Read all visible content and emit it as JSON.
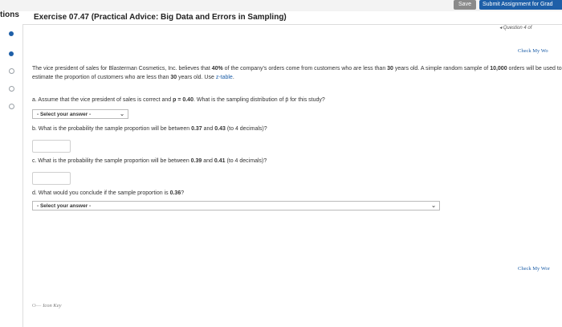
{
  "topbar": {
    "save_label": "Save",
    "submit_label": "Submit Assignment for Grad"
  },
  "sidebar": {
    "label": "tions"
  },
  "exercise": {
    "title": "Exercise 07.47 (Practical Advice: Big Data and Errors in Sampling)"
  },
  "question_nav": {
    "label": "Question 4 of"
  },
  "check_my_work": {
    "top": "Check My Wo",
    "bottom": "Check My Wor"
  },
  "problem": {
    "pre1": "The vice president of sales for Blasterman Cosmetics, Inc. believes that ",
    "pct": "40%",
    "mid1": " of the company's orders come from customers who are less than ",
    "age1": "30",
    "end1": " years old.",
    "pre2": "A simple random sample of ",
    "n": "10,000",
    "mid2": " orders will be used to estimate the proportion of customers who are less than ",
    "age2": "30",
    "mid3": " years old. Use ",
    "ztable": "z-table",
    "end2": "."
  },
  "part_a": {
    "prefix": "a. Assume that the vice president of sales is correct and ",
    "p_expr": "p = 0.40",
    "suffix": ". What is the sampling distribution of p̄ for this study?",
    "select_value": "- Select your answer -"
  },
  "part_b": {
    "prefix": "b. What is the probability the sample proportion will be between ",
    "low": "0.37",
    "and": " and ",
    "high": "0.43",
    "suffix": " (to 4 decimals)?"
  },
  "part_c": {
    "prefix": "c. What is the probability the sample proportion will be between ",
    "low": "0.39",
    "and": " and ",
    "high": "0.41",
    "suffix": " (to 4 decimals)?"
  },
  "part_d": {
    "prefix": "d. What would you conclude if the sample proportion is ",
    "value": "0.36",
    "suffix": "?",
    "select_value": "- Select your answer -"
  },
  "footer": {
    "icon_key_label": "Icon Key"
  },
  "colors": {
    "accent": "#1e5fa8",
    "save_bg": "#8a8a8a",
    "text": "#333333"
  }
}
